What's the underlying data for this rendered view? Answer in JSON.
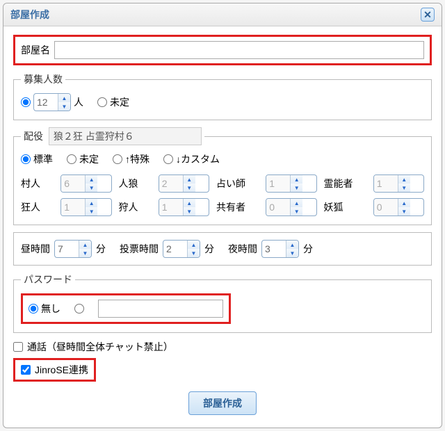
{
  "dialog": {
    "title": "部屋作成"
  },
  "room_name": {
    "label": "部屋名",
    "value": ""
  },
  "recruit": {
    "legend": "募集人数",
    "count": "12",
    "unit": "人",
    "undecided": "未定"
  },
  "roles": {
    "legend": "配役",
    "summary": "狼２狂 占霊狩村６",
    "opt_standard": "標準",
    "opt_undecided": "未定",
    "opt_special": "↑特殊",
    "opt_custom": "↓カスタム",
    "villager_label": "村人",
    "villager": "6",
    "werewolf_label": "人狼",
    "werewolf": "2",
    "seer_label": "占い師",
    "seer": "1",
    "medium_label": "霊能者",
    "medium": "1",
    "madman_label": "狂人",
    "madman": "1",
    "hunter_label": "狩人",
    "hunter": "1",
    "mason_label": "共有者",
    "mason": "0",
    "fox_label": "妖狐",
    "fox": "0"
  },
  "time": {
    "day_label": "昼時間",
    "day": "7",
    "day_unit": "分",
    "vote_label": "投票時間",
    "vote": "2",
    "vote_unit": "分",
    "night_label": "夜時間",
    "night": "3",
    "night_unit": "分"
  },
  "password": {
    "legend": "パスワード",
    "none_label": "無し",
    "value": ""
  },
  "voice": {
    "label": "通話（昼時間全体チャット禁止）",
    "checked": false
  },
  "jinrose": {
    "label": "JinroSE連携",
    "checked": true
  },
  "submit": "部屋作成"
}
